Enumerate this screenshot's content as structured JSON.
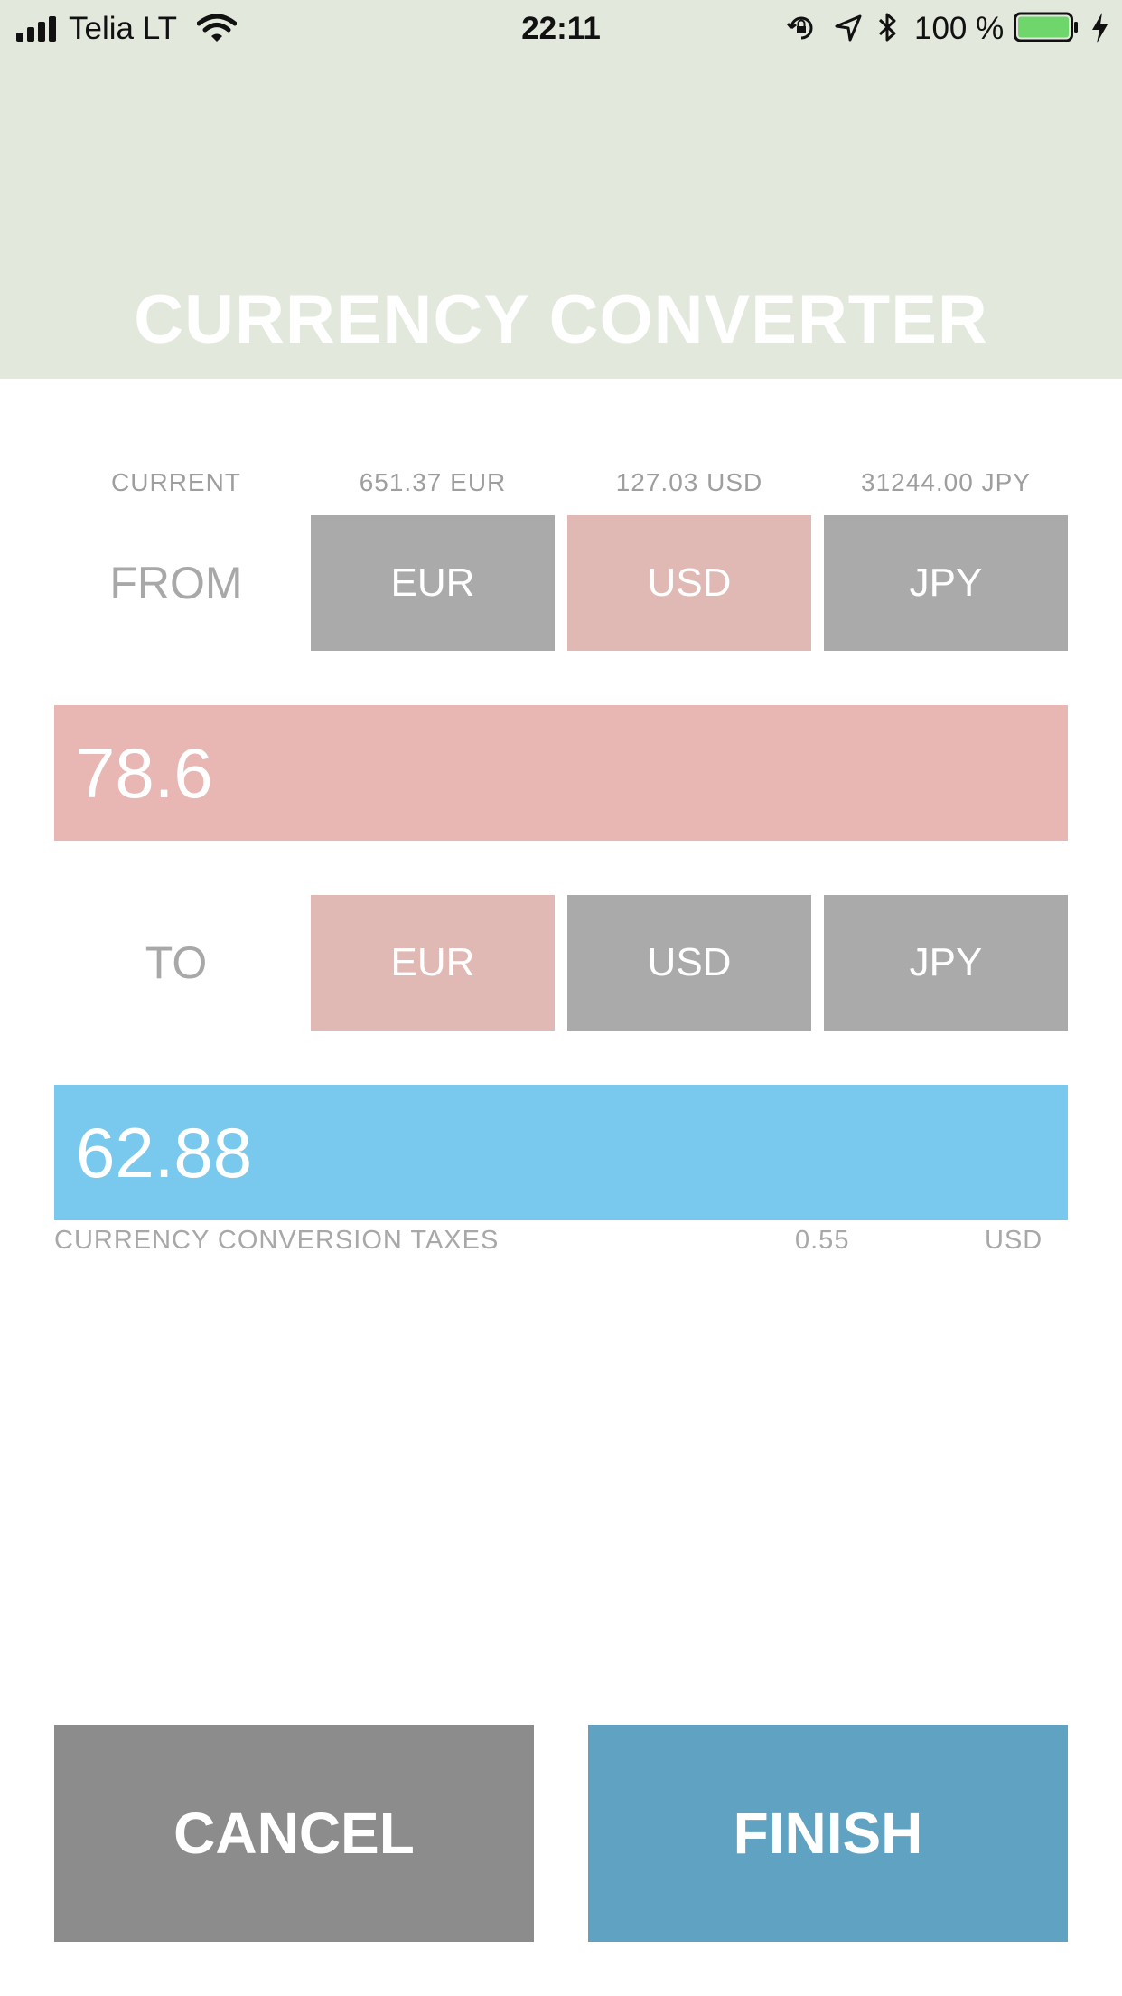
{
  "status_bar": {
    "carrier": "Telia LT",
    "time": "22:11",
    "battery_percent": "100 %",
    "battery_level": 1.0,
    "battery_color": "#6fd66b"
  },
  "header": {
    "title": "CURRENCY CONVERTER",
    "background": "#e2e8dc"
  },
  "balances": {
    "label": "CURRENT",
    "eur": "651.37 EUR",
    "usd": "127.03 USD",
    "jpy": "31244.00 JPY"
  },
  "from": {
    "label": "FROM",
    "options": [
      "EUR",
      "USD",
      "JPY"
    ],
    "selected": "USD",
    "amount": "78.6"
  },
  "to": {
    "label": "TO",
    "options": [
      "EUR",
      "USD",
      "JPY"
    ],
    "selected": "EUR",
    "amount": "62.88"
  },
  "taxes": {
    "label": "CURRENCY CONVERSION TAXES",
    "value": "0.55",
    "currency": "USD"
  },
  "actions": {
    "cancel": "CANCEL",
    "finish": "FINISH"
  },
  "colors": {
    "selected_currency": "#e0b8b4",
    "unselected_currency": "#aaaaaa",
    "from_amount": "#e8b7b4",
    "to_amount": "#78c9ed",
    "cancel": "#8c8c8c",
    "finish": "#5fa2c1"
  }
}
